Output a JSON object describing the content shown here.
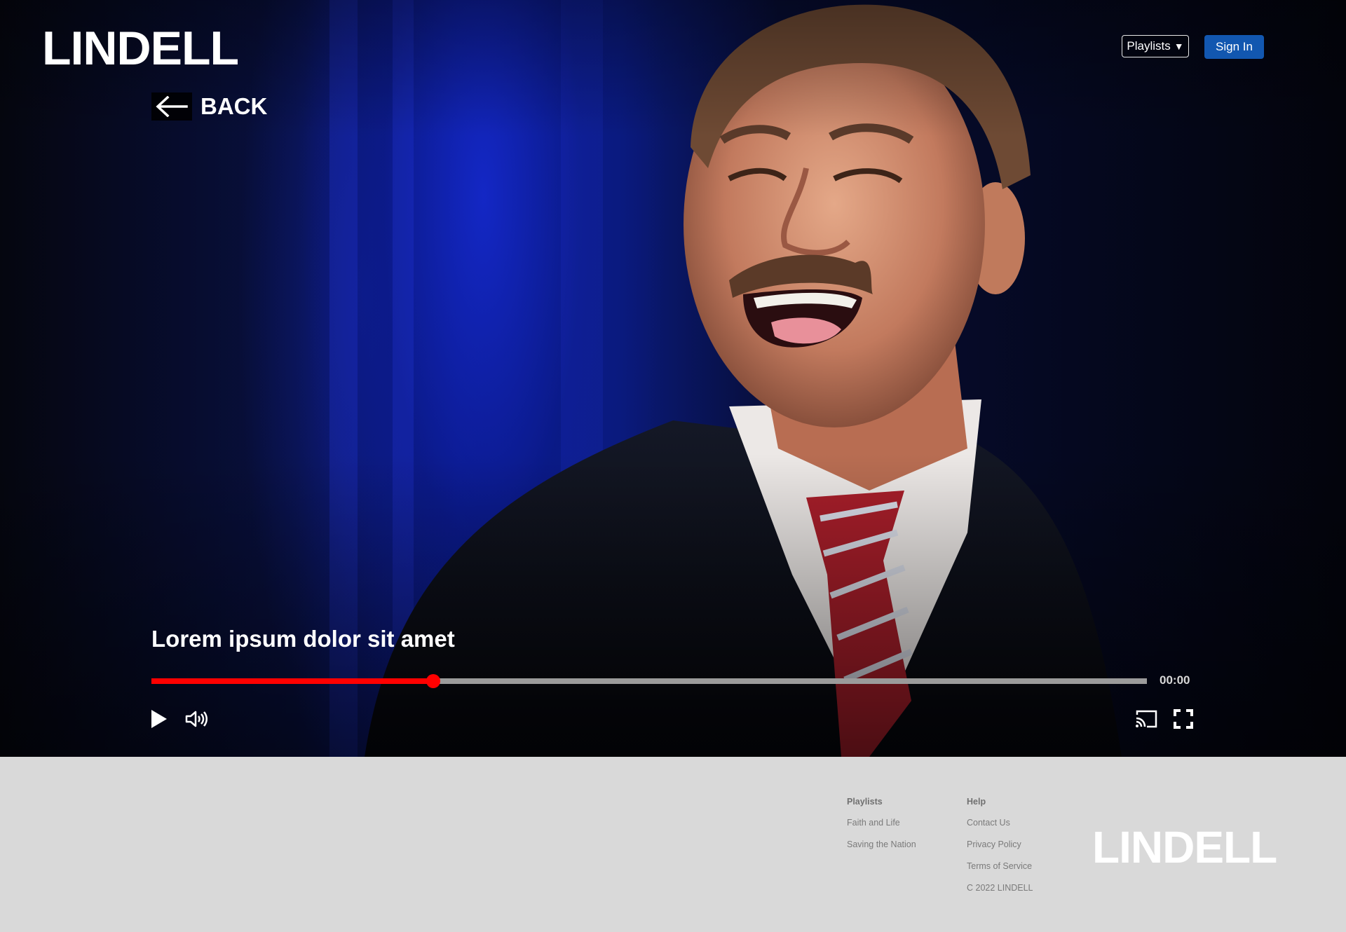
{
  "header": {
    "logo": "LINDELL",
    "playlists_label": "Playlists",
    "signin_label": "Sign In"
  },
  "nav": {
    "back_label": "BACK"
  },
  "player": {
    "title": "Lorem ipsum dolor sit amet",
    "time": "00:00",
    "progress": 0.283,
    "icons": [
      "play-icon",
      "volume-icon",
      "cast-icon",
      "fullscreen-icon"
    ]
  },
  "footer": {
    "playlists_heading": "Playlists",
    "playlists_links": [
      "Faith and Life",
      "Saving the Nation"
    ],
    "help_heading": "Help",
    "help_links": [
      "Contact Us",
      "Privacy Policy",
      "Terms of Service"
    ],
    "copyright": "C 2022 LINDELL",
    "logo": "LINDELL"
  },
  "colors": {
    "accent": "#ff0000",
    "signin": "#1257b0",
    "footer_bg": "#d9d9d9"
  }
}
